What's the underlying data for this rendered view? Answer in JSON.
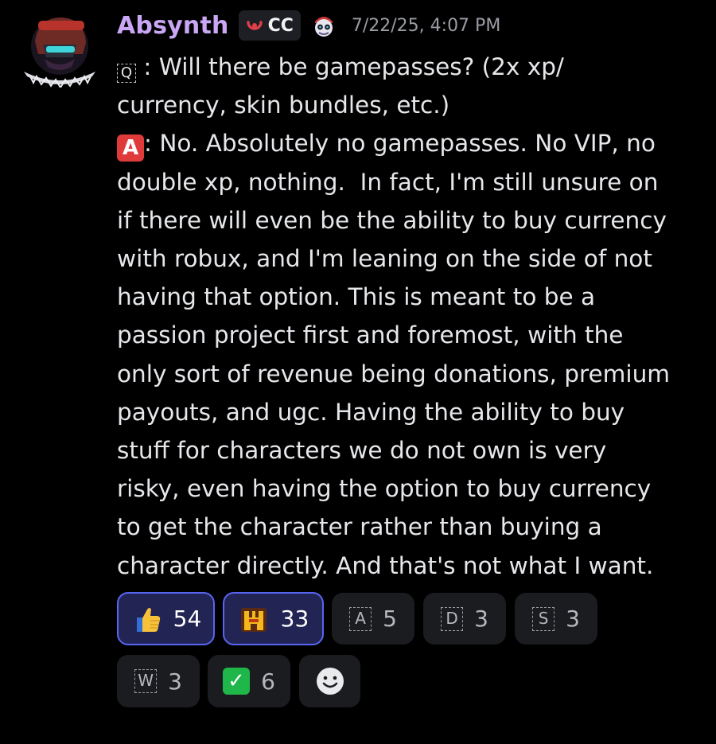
{
  "author": {
    "name": "Absynth",
    "tag": "CC",
    "timestamp": "7/22/25, 4:07 PM"
  },
  "message": {
    "question_marker": "Q",
    "question_text": " : Will there be gamepasses? (2x xp/\ncurrency, skin bundles, etc.)\n",
    "answer_marker": "A",
    "answer_text": ": No. Absolutely no gamepasses. No VIP, no\ndouble xp, nothing.  In fact, I'm still unsure on\nif there will even be the ability to buy currency\nwith robux, and I'm leaning on the side of not\nhaving that option. This is meant to be a\npassion project first and foremost, with the\nonly sort of revenue being donations, premium\npayouts, and ugc. Having the ability to buy\nstuff for characters we do not own is very\nrisky, even having the option to buy currency\nto get the character rather than buying a\ncharacter directly. And that's not what I want."
  },
  "reactions": [
    {
      "emoji": "thumbs-up",
      "count": "54",
      "active": true
    },
    {
      "emoji": "custom-yellow-character",
      "count": "33",
      "active": true
    },
    {
      "emoji": "regional-a",
      "letter": "A",
      "count": "5",
      "active": false
    },
    {
      "emoji": "regional-d",
      "letter": "D",
      "count": "3",
      "active": false
    },
    {
      "emoji": "regional-s",
      "letter": "S",
      "count": "3",
      "active": false
    },
    {
      "emoji": "regional-w",
      "letter": "W",
      "count": "3",
      "active": false
    },
    {
      "emoji": "check-mark",
      "count": "6",
      "active": false
    },
    {
      "emoji": "add-reaction",
      "count": "",
      "active": false
    }
  ],
  "colors": {
    "background": "#000000",
    "username": "#c9a7f5",
    "active_reaction_border": "#5865f2",
    "answer_marker": "#e03b3b",
    "check_mark": "#1fb64a"
  }
}
